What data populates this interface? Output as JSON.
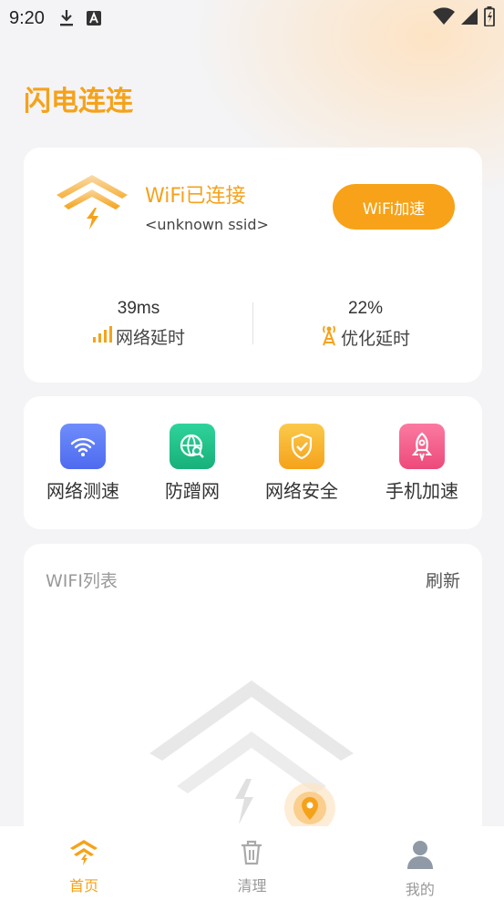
{
  "status_bar": {
    "time": "9:20",
    "icons": [
      "download-icon",
      "a-badge-icon"
    ],
    "right_icons": [
      "wifi-signal-icon",
      "cell-signal-icon",
      "battery-icon"
    ]
  },
  "app": {
    "title": "闪电连连",
    "accent": "#f5a21b"
  },
  "connection": {
    "state": "WiFi已连接",
    "ssid": "<unknown ssid>",
    "boost_label": "WiFi加速",
    "latency_value": "39ms",
    "latency_label": "网络延时",
    "optimize_value": "22%",
    "optimize_label": "优化延时"
  },
  "tools": [
    {
      "label": "网络测速",
      "icon": "wifi-icon",
      "color": "#5b7cf5"
    },
    {
      "label": "防蹭网",
      "icon": "globe-search-icon",
      "color": "#22c08e"
    },
    {
      "label": "网络安全",
      "icon": "shield-check-icon",
      "color": "#f7b731"
    },
    {
      "label": "手机加速",
      "icon": "rocket-icon",
      "color": "#f25a87"
    }
  ],
  "wifi_list": {
    "title": "WIFI列表",
    "refresh_label": "刷新"
  },
  "tabs": [
    {
      "label": "首页",
      "icon": "home-logo-icon",
      "active": true
    },
    {
      "label": "清理",
      "icon": "trash-icon",
      "active": false
    },
    {
      "label": "我的",
      "icon": "user-icon",
      "active": false
    }
  ]
}
